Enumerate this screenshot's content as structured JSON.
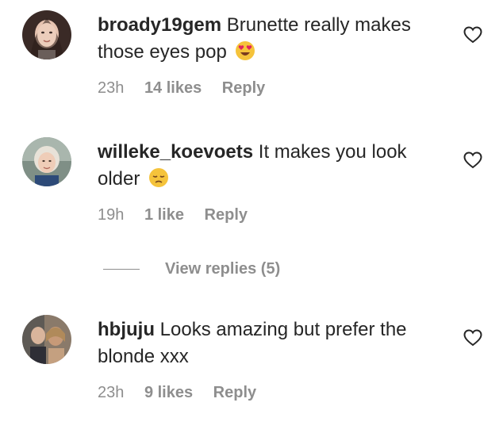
{
  "comments": [
    {
      "username": "broady19gem",
      "text": "Brunette really makes those eyes pop",
      "emoji": "heart-eyes-emoji",
      "time": "23h",
      "likes": "14 likes",
      "reply_label": "Reply"
    },
    {
      "username": "willeke_koevoets",
      "text": "It makes you look older",
      "emoji": "pensive-face-emoji",
      "time": "19h",
      "likes": "1 like",
      "reply_label": "Reply"
    },
    {
      "username": "hbjuju",
      "text": "Looks amazing but prefer the blonde xxx",
      "time": "23h",
      "likes": "9 likes",
      "reply_label": "Reply"
    }
  ],
  "view_replies": {
    "label": "View replies (5)"
  },
  "colors": {
    "text": "#262626",
    "muted": "#8e8e8e",
    "emoji_yellow": "#f5c33b",
    "heart_red": "#e0245e"
  }
}
